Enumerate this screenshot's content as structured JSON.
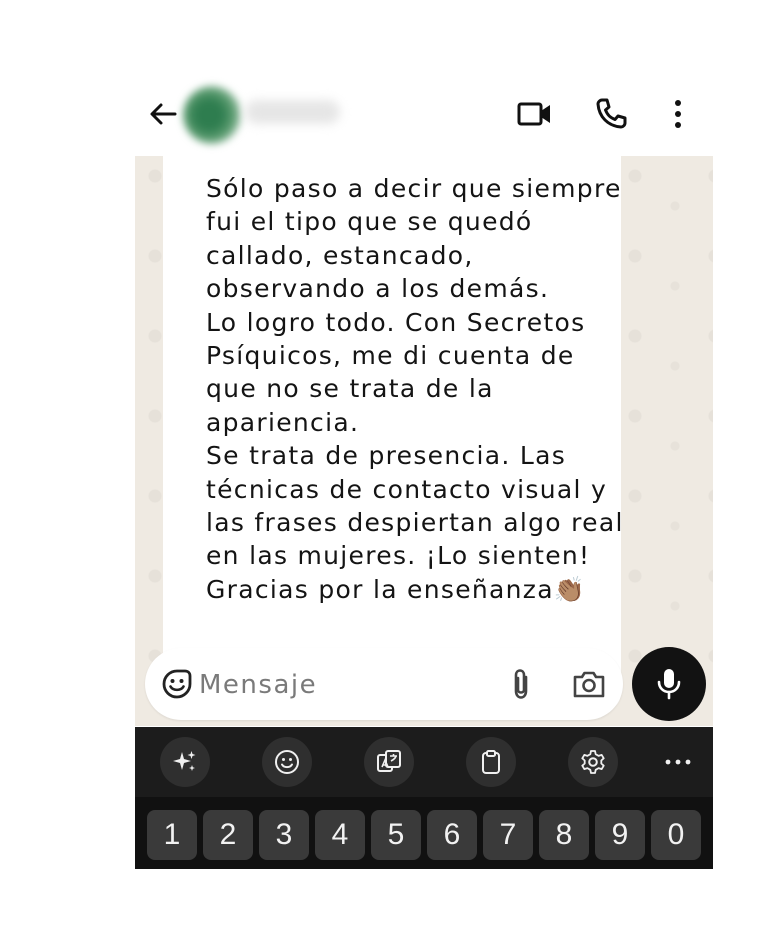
{
  "message": {
    "lines": [
      "Sólo paso a decir que siempre",
      "fui el tipo que se quedó",
      "callado, estancado,",
      "observando a los demás.",
      "Lo logro todo. Con Secretos",
      "Psíquicos, me di cuenta de",
      "que no se trata de la",
      "apariencia.",
      "Se trata de presencia. Las",
      "técnicas de contacto visual y",
      "las frases despiertan algo real",
      "en las mujeres. ¡Lo sienten!",
      "Gracias por la enseñanza👏🏽"
    ]
  },
  "composer": {
    "placeholder": "Mensaje"
  },
  "keyboard": {
    "tools": [
      "sparkle-icon",
      "emoji-icon",
      "translate-icon",
      "clipboard-icon",
      "settings-icon",
      "more-icon"
    ],
    "number_keys": [
      "1",
      "2",
      "3",
      "4",
      "5",
      "6",
      "7",
      "8",
      "9",
      "0"
    ]
  },
  "colors": {
    "chat_background": "#efeae2",
    "bubble": "#ffffff",
    "keyboard": "#1c1c1c",
    "mic_button": "#121212"
  }
}
